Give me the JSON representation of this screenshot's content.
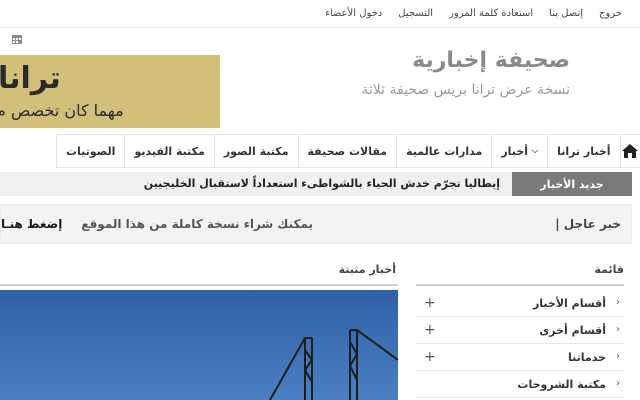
{
  "topbar": {
    "links": [
      "دخول الأعضاء",
      "التسجيل",
      "استعادة كلمة المرور",
      "إتصل بنا",
      "خروج"
    ]
  },
  "header": {
    "title": "صحيفة إخبارية",
    "subtitle": "نسخة عرض ترانا بريس صحيفة ثلاثة"
  },
  "banner": {
    "big": "ترانا",
    "small": "مهما كان تخصص م"
  },
  "nav": {
    "items": [
      "أخبار ترانا",
      "أخبار",
      "مدارات عالمية",
      "مقالات صحيفة",
      "مكتبة الصور",
      "مكتبة الفيديو",
      "الصوتيات"
    ]
  },
  "ticker": {
    "label": "جديد الأخبار",
    "text": "إيطاليا تجرّم خدش الحياء بالشواطىء استعداداً لاستقبال الخليجيين"
  },
  "breaking": {
    "label": "خبر عاجل |",
    "text": "يمكنك شراء نسخة كاملة من هذا الموقع",
    "link": "إضغط هنـا"
  },
  "fixed_news": {
    "title": "أخبار مثبتة"
  },
  "menu": {
    "title": "قائمة",
    "items": [
      {
        "label": "أقسام الأخبار",
        "expand": "+"
      },
      {
        "label": "أقسام أخرى",
        "expand": "+"
      },
      {
        "label": "خدماتنا",
        "expand": "+"
      },
      {
        "label": "مكتبة الشروحات",
        "expand": ""
      }
    ]
  },
  "colors": {
    "banner": "#d2c07a",
    "ticker_label": "#7a7a7a",
    "photo_sky": "#3a6db3"
  },
  "icons": [
    "calendar-icon",
    "home-icon",
    "chevron-down-icon",
    "chevron-right-icon",
    "plus-icon"
  ]
}
